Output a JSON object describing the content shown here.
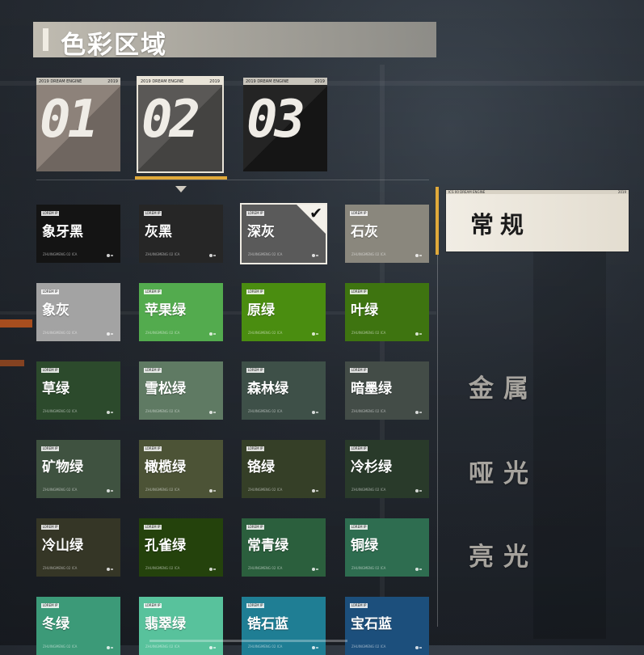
{
  "header": {
    "title": "色彩区域"
  },
  "region_tabs": [
    {
      "num": "01",
      "strip_left": "2019 DREAM ENGINE",
      "strip_right": "2019",
      "selected": false
    },
    {
      "num": "02",
      "strip_left": "2019 DREAM ENGINE",
      "strip_right": "2019",
      "selected": true
    },
    {
      "num": "03",
      "strip_left": "2019 DREAM ENGINE",
      "strip_right": "2019",
      "selected": false
    }
  ],
  "swatch_tag": "LOREM IP",
  "swatch_sub": "ZHUINGMENG 02 ICA",
  "swatches": [
    {
      "name": "象牙黑",
      "color": "#141414"
    },
    {
      "name": "灰黑",
      "color": "#262626"
    },
    {
      "name": "深灰",
      "color": "#5a5a5a",
      "selected": true
    },
    {
      "name": "石灰",
      "color": "#8a877d"
    },
    {
      "name": "象灰",
      "color": "#a3a3a3"
    },
    {
      "name": "苹果绿",
      "color": "#53ab4e"
    },
    {
      "name": "原绿",
      "color": "#4a8d10"
    },
    {
      "name": "叶绿",
      "color": "#3e7410"
    },
    {
      "name": "草绿",
      "color": "#2c4a2c"
    },
    {
      "name": "雪松绿",
      "color": "#5f7a63"
    },
    {
      "name": "森林绿",
      "color": "#3e5048"
    },
    {
      "name": "暗墨绿",
      "color": "#434c47"
    },
    {
      "name": "矿物绿",
      "color": "#3f5240"
    },
    {
      "name": "橄榄绿",
      "color": "#4c5336"
    },
    {
      "name": "铬绿",
      "color": "#353f27"
    },
    {
      "name": "冷杉绿",
      "color": "#293a2a"
    },
    {
      "name": "冷山绿",
      "color": "#353626"
    },
    {
      "name": "孔雀绿",
      "color": "#24420c"
    },
    {
      "name": "常青绿",
      "color": "#2b5f3d"
    },
    {
      "name": "铜绿",
      "color": "#2e6d50"
    },
    {
      "name": "冬绿",
      "color": "#3c9a78"
    },
    {
      "name": "翡翠绿",
      "color": "#58c29c"
    },
    {
      "name": "锆石蓝",
      "color": "#1f7e94"
    },
    {
      "name": "宝石蓝",
      "color": "#1c4f7c"
    }
  ],
  "categories": {
    "active": "常规",
    "active_strip_left": "ICS 00 DREAM ENGINE",
    "active_strip_right": "2019",
    "items": [
      "金属",
      "哑光",
      "亮光"
    ]
  },
  "colors": {
    "accent": "#e0a93a",
    "selected_outline": "#f0ece3"
  },
  "icons": {
    "check": "checkmark-icon",
    "caret": "caret-down-icon"
  }
}
